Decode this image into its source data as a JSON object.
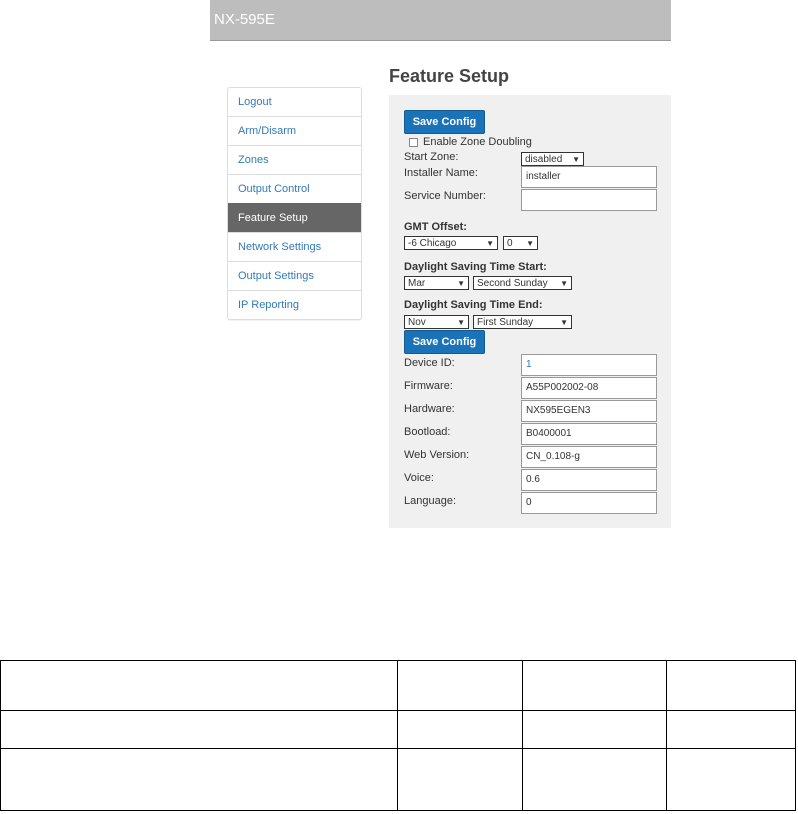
{
  "header": {
    "title": "NX-595E"
  },
  "sidebar": {
    "items": [
      {
        "label": "Logout"
      },
      {
        "label": "Arm/Disarm"
      },
      {
        "label": "Zones"
      },
      {
        "label": "Output Control"
      },
      {
        "label": "Feature Setup",
        "active": true
      },
      {
        "label": "Network Settings"
      },
      {
        "label": "Output Settings"
      },
      {
        "label": "IP Reporting"
      }
    ]
  },
  "main": {
    "title": "Feature Setup",
    "save_label": "Save Config",
    "zone_doubling_label": "Enable Zone Doubling",
    "zone_doubling_checked": false,
    "start_zone": {
      "label": "Start Zone:",
      "value": "disabled"
    },
    "installer_name": {
      "label": "Installer Name:",
      "value": "installer"
    },
    "service_number": {
      "label": "Service Number:",
      "value": ""
    },
    "gmt": {
      "label": "GMT Offset:",
      "zone": "-6 Chicago",
      "minutes": "0"
    },
    "dst_start": {
      "label": "Daylight Saving Time Start:",
      "month": "Mar",
      "week": "Second Sunday"
    },
    "dst_end": {
      "label": "Daylight Saving Time End:",
      "month": "Nov",
      "week": "First Sunday"
    },
    "info": [
      {
        "label": "Device ID:",
        "value": "1"
      },
      {
        "label": "Firmware:",
        "value": "A55P002002-08"
      },
      {
        "label": "Hardware:",
        "value": "NX595EGEN3"
      },
      {
        "label": "Bootload:",
        "value": "B0400001"
      },
      {
        "label": "Web Version:",
        "value": "CN_0.108-g"
      },
      {
        "label": "Voice:",
        "value": "0.6"
      },
      {
        "label": "Language:",
        "value": "0"
      }
    ]
  },
  "colors": {
    "accent": "#1a73b8",
    "link": "#337ab7",
    "active_nav": "#666666",
    "banner": "#bdbdbd"
  }
}
